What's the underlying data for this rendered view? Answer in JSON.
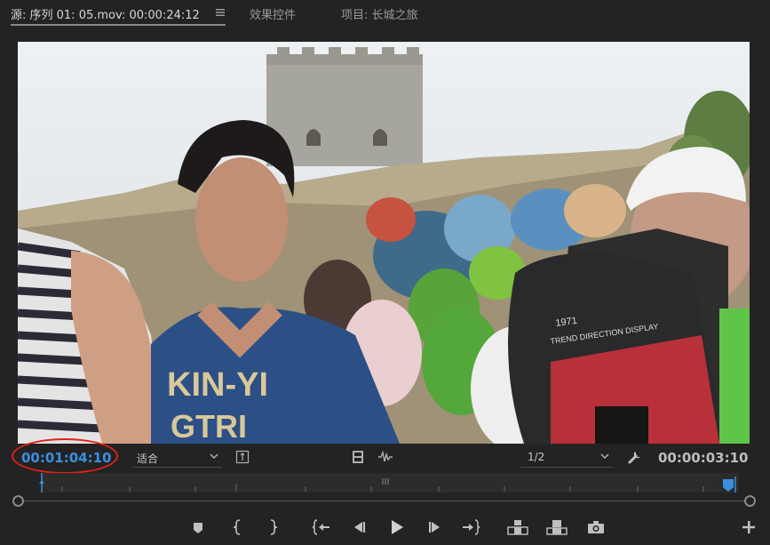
{
  "tabs": [
    {
      "label": "源: 序列 01: 05.mov: 00:00:24:12"
    },
    {
      "label": "效果控件"
    },
    {
      "label": "项目: 长城之旅"
    }
  ],
  "viewer": {
    "shirt_text_line1": "KIN-YI",
    "shirt_text_line2": "GTRI",
    "bag_text_line1": "1971",
    "bag_text_line2": "TREND DIRECTION DISPLAY"
  },
  "controls": {
    "playhead_timecode": "00:01:04:10",
    "zoom_value": "适合",
    "resolution_value": "1/2",
    "duration_timecode": "00:00:03:10"
  },
  "colors": {
    "accent_blue": "#3a8fe0",
    "highlight_circle": "#e0201c"
  },
  "transport_icons": [
    "add-marker-icon",
    "mark-in-icon",
    "mark-out-icon",
    "go-to-in-icon",
    "step-back-icon",
    "play-icon",
    "step-forward-icon",
    "go-to-out-icon",
    "insert-icon",
    "overwrite-icon",
    "export-frame-icon",
    "button-editor-icon"
  ]
}
